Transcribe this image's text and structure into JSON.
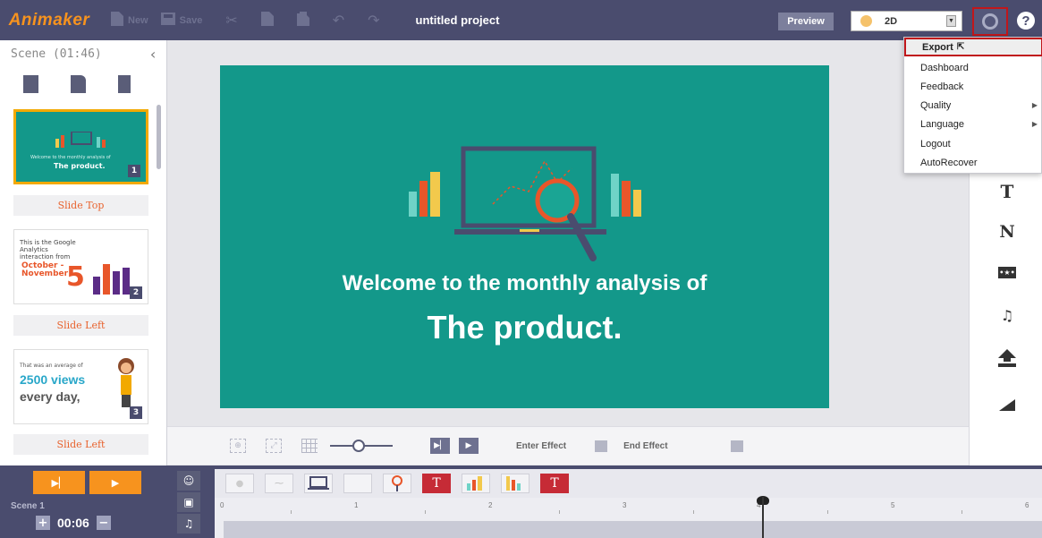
{
  "app": {
    "logo": "Animaker",
    "project_title": "untitled project"
  },
  "toolbar": {
    "new_label": "New",
    "save_label": "Save",
    "preview_label": "Preview",
    "mode_value": "2D",
    "help_label": "?"
  },
  "scenes_panel": {
    "header": "Scene  (01:46)",
    "collapse_glyph": "‹",
    "slides": [
      {
        "number": "1",
        "subtitle": "Welcome to the monthly analysis of",
        "title": "The product."
      },
      {
        "number": "2",
        "line1": "This is the Google Analytics interaction from",
        "months": "October - November",
        "big_number": "5"
      },
      {
        "number": "3",
        "line1": "That was an average of",
        "line2": "2500 views",
        "line3": "every day,"
      }
    ],
    "transitions": [
      "Slide Top",
      "Slide Left",
      "Slide Left"
    ]
  },
  "stage": {
    "line1": "Welcome to the monthly analysis of",
    "line2": "The product."
  },
  "controls": {
    "enter_effect": "Enter Effect",
    "end_effect": "End Effect",
    "zoom_level": 0.45
  },
  "settings_menu": {
    "items": [
      {
        "label": "Export",
        "has_submenu": false
      },
      {
        "label": "Dashboard",
        "has_submenu": false
      },
      {
        "label": "Feedback",
        "has_submenu": false
      },
      {
        "label": "Quality",
        "has_submenu": true
      },
      {
        "label": "Language",
        "has_submenu": true
      },
      {
        "label": "Logout",
        "has_submenu": false
      },
      {
        "label": "AutoRecover",
        "has_submenu": false
      }
    ]
  },
  "tools_panel": {
    "text_tool": "T",
    "number_tool": "N",
    "badge_tool": "•★•",
    "music_tool": "♫"
  },
  "timeline": {
    "scene_label": "Scene 1",
    "duration": "00:06",
    "plus": "+",
    "minus": "−",
    "ruler_ticks": [
      "0",
      "1",
      "2",
      "3",
      "4",
      "5",
      "6"
    ],
    "strip_text_marks": [
      "T",
      "T"
    ]
  },
  "colors": {
    "topbar": "#4a4c6e",
    "accent_orange": "#f7931e",
    "stage_teal": "#13988a",
    "highlight_red": "#c0171b"
  },
  "icons": {
    "new": "new-file-icon",
    "save": "save-icon",
    "cut": "scissors-icon",
    "copy": "copy-icon",
    "paste": "paste-icon",
    "undo": "undo-icon",
    "redo": "redo-icon",
    "settings": "gear-icon",
    "help": "help-icon"
  }
}
